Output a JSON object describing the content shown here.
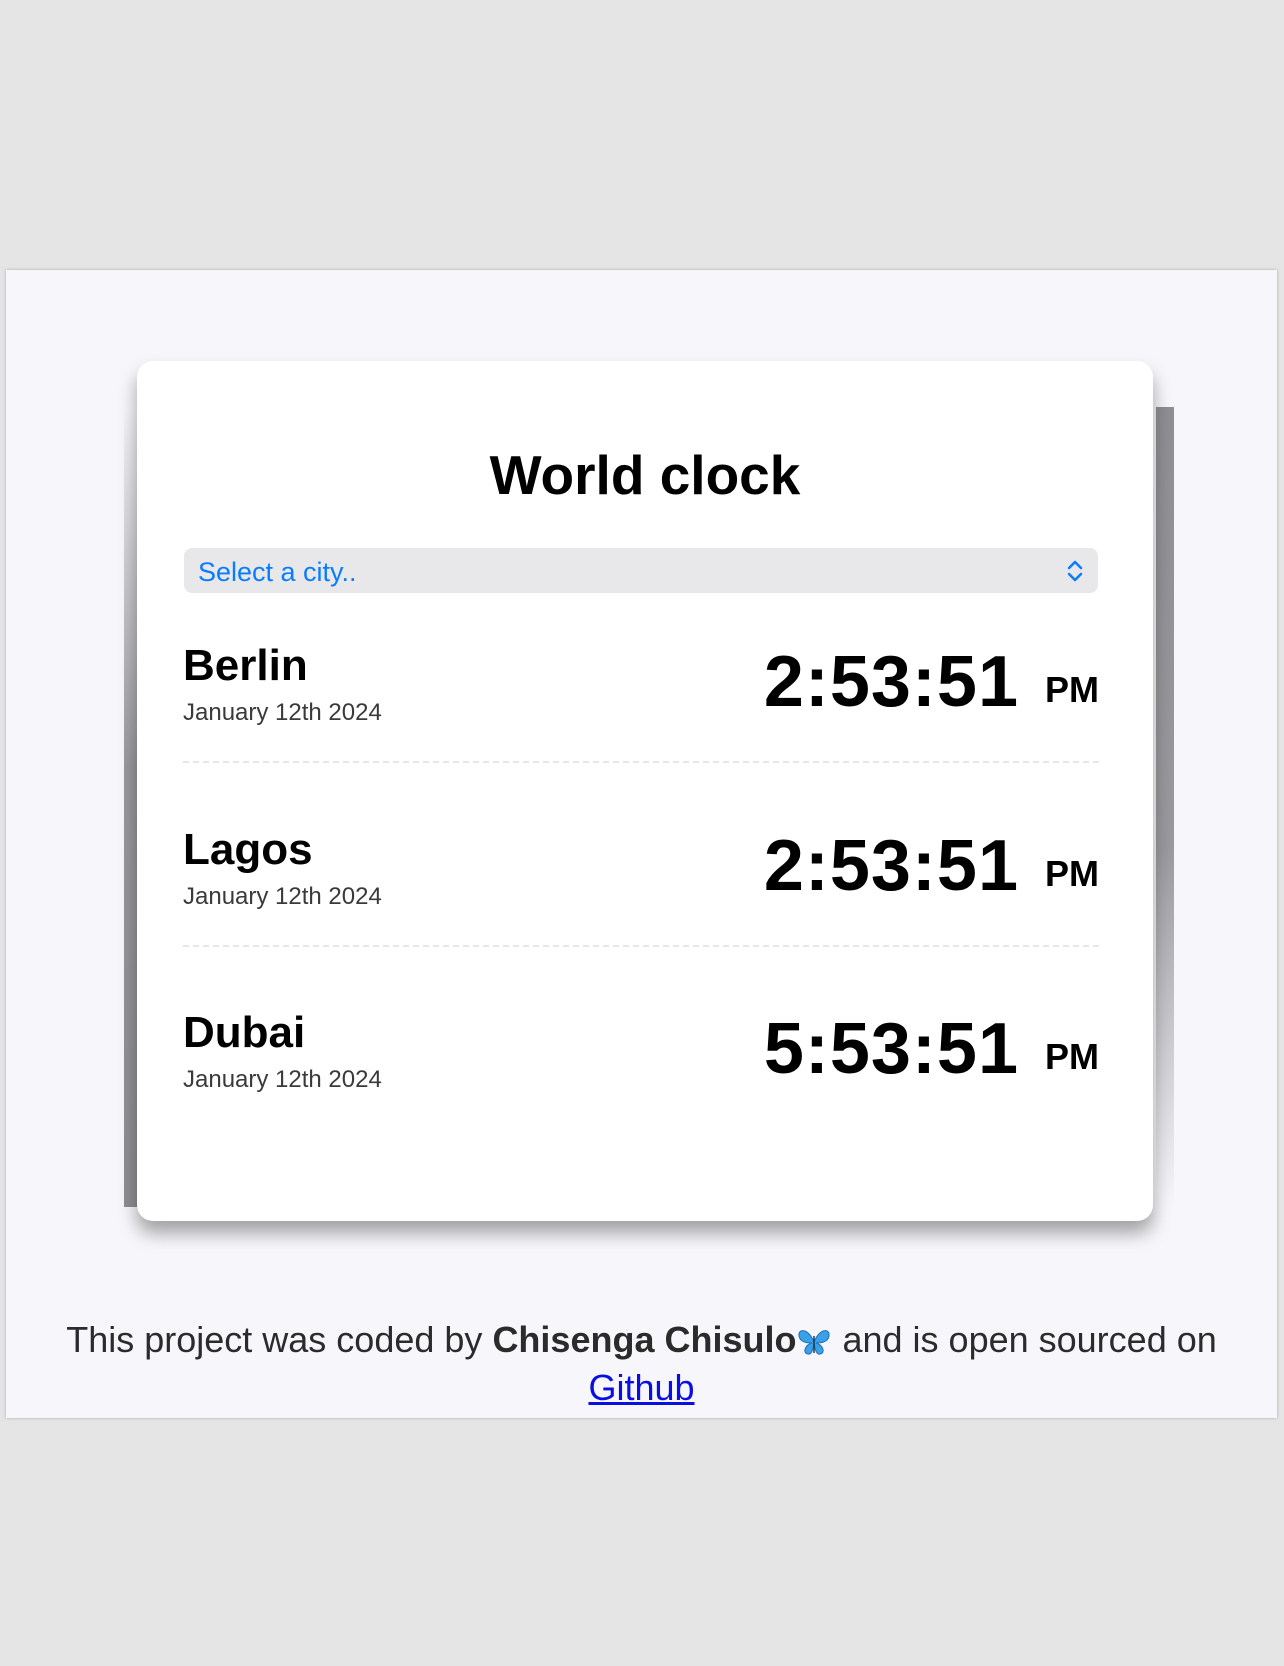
{
  "app": {
    "title": "World clock"
  },
  "select": {
    "placeholder": "Select a city.."
  },
  "cities": [
    {
      "name": "Berlin",
      "date": "January 12th 2024",
      "time": "2:53:51",
      "ampm": "PM"
    },
    {
      "name": "Lagos",
      "date": "January 12th 2024",
      "time": "2:53:51",
      "ampm": "PM"
    },
    {
      "name": "Dubai",
      "date": "January 12th 2024",
      "time": "5:53:51",
      "ampm": "PM"
    }
  ],
  "footer": {
    "prefix": "This project was coded by",
    "author": "Chisenga Chisulo",
    "suffix": "and is open sourced on",
    "link_label": "Github"
  },
  "colors": {
    "accent": "#0a7cff",
    "link": "#0a0ee0",
    "background": "#f7f7fb",
    "card": "#ffffff"
  },
  "icons": {
    "select": "chevron-up-down-icon",
    "author": "butterfly-icon"
  }
}
